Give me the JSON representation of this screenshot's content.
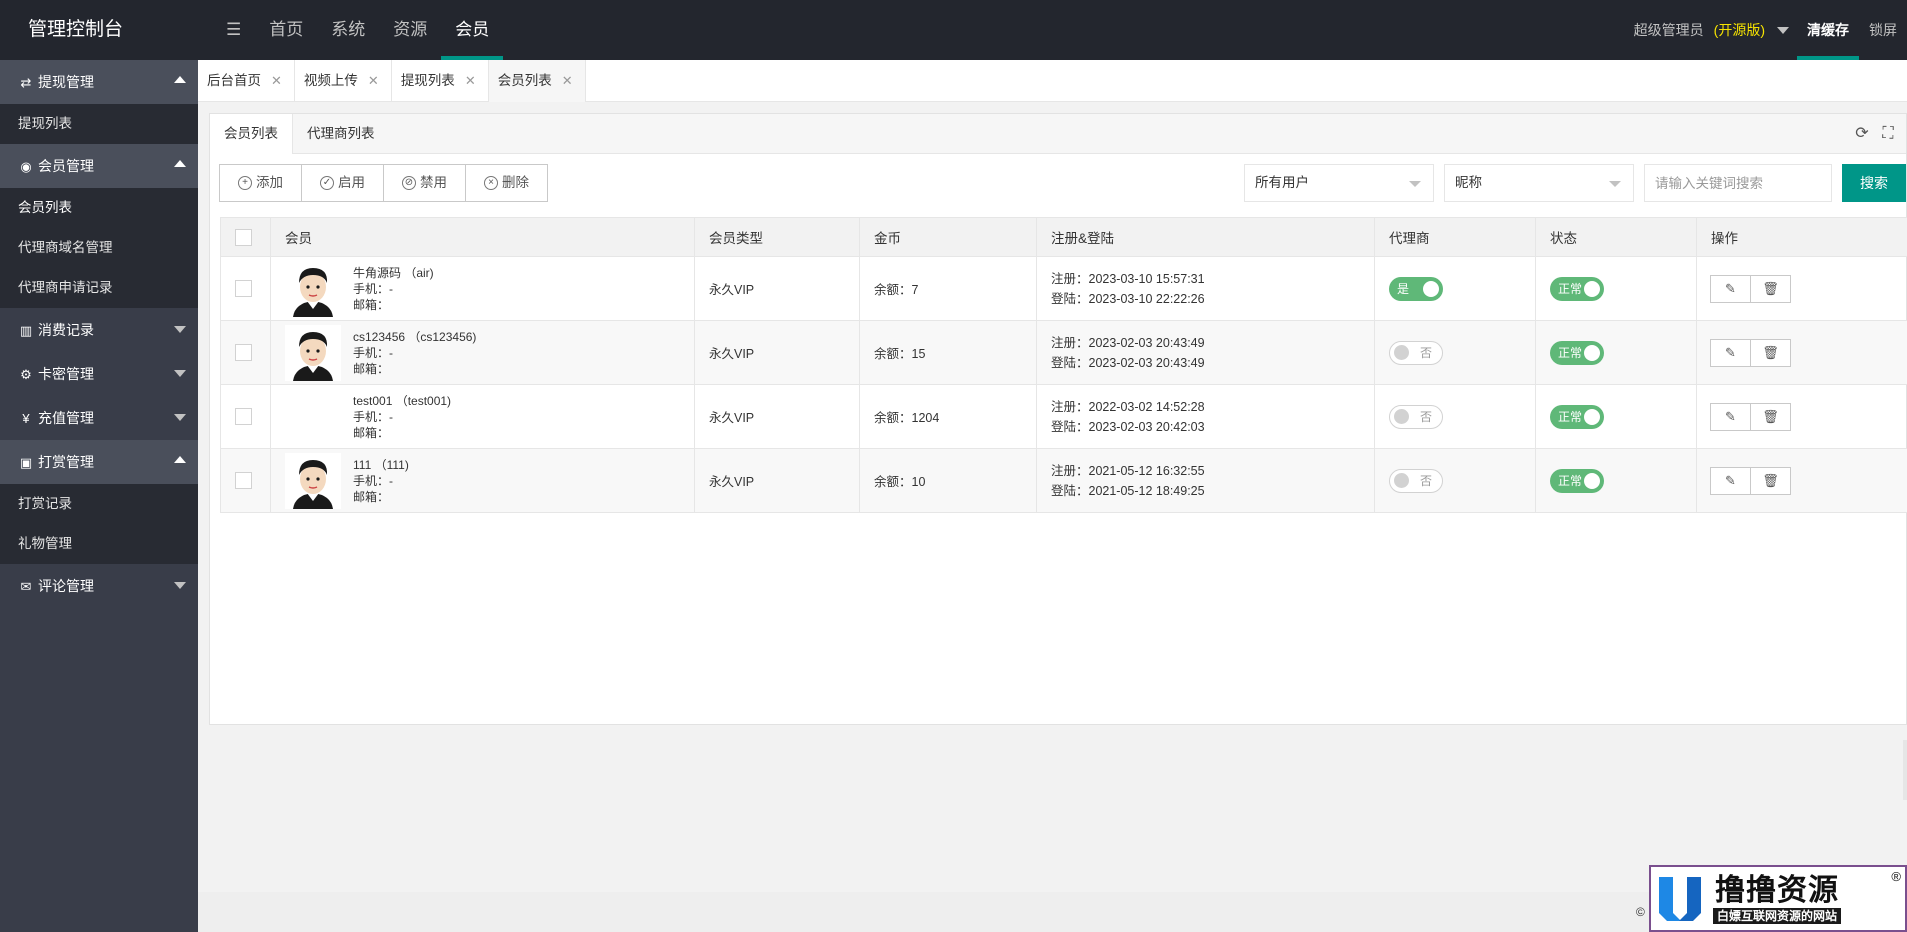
{
  "header": {
    "brand": "管理控制台",
    "menu_icon": "menu-icon",
    "nav": [
      "首页",
      "系统",
      "资源",
      "会员"
    ],
    "active_nav": "会员",
    "user": "超级管理员",
    "edition": "(开源版)",
    "clear_cache": "清缓存",
    "lock": "锁屏"
  },
  "sidebar": {
    "groups": [
      {
        "label": "提现管理",
        "icon": "exchange-icon",
        "open": true,
        "items": [
          "提现列表"
        ]
      },
      {
        "label": "会员管理",
        "icon": "user-circle-icon",
        "open": true,
        "items": [
          "会员列表",
          "代理商域名管理",
          "代理商申请记录"
        ]
      },
      {
        "label": "消费记录",
        "icon": "bar-chart-icon",
        "open": false,
        "items": []
      },
      {
        "label": "卡密管理",
        "icon": "gear-icon",
        "open": false,
        "items": []
      },
      {
        "label": "充值管理",
        "icon": "yen-icon",
        "open": false,
        "items": []
      },
      {
        "label": "打赏管理",
        "icon": "money-icon",
        "open": true,
        "items": [
          "打赏记录",
          "礼物管理"
        ]
      },
      {
        "label": "评论管理",
        "icon": "comment-icon",
        "open": false,
        "items": []
      }
    ]
  },
  "tabs": [
    {
      "label": "后台首页"
    },
    {
      "label": "视频上传"
    },
    {
      "label": "提现列表"
    },
    {
      "label": "会员列表",
      "active": true
    }
  ],
  "subtabs": [
    "会员列表",
    "代理商列表"
  ],
  "toolbar": {
    "add": "添加",
    "enable": "启用",
    "disable": "禁用",
    "delete": "删除"
  },
  "filters": {
    "user_type": "所有用户",
    "field": "昵称",
    "search_placeholder": "请输入关键词搜索",
    "search_button": "搜索"
  },
  "table": {
    "headers": [
      "会员",
      "会员类型",
      "金币",
      "注册&登陆",
      "代理商",
      "状态",
      "操作"
    ],
    "rows": [
      {
        "name": "牛角源码 （air)",
        "has_avatar": true,
        "phone": "手机：-",
        "email": "邮箱：",
        "type": "永久VIP",
        "balance": "余额：7",
        "register": "注册：2023-03-10 15:57:31",
        "login": "登陆：2023-03-10 22:22:26",
        "agent": "是",
        "agent_on": true,
        "status": "正常"
      },
      {
        "name": "cs123456 （cs123456)",
        "has_avatar": true,
        "phone": "手机：-",
        "email": "邮箱：",
        "type": "永久VIP",
        "balance": "余额：15",
        "register": "注册：2023-02-03 20:43:49",
        "login": "登陆：2023-02-03 20:43:49",
        "agent": "否",
        "agent_on": false,
        "status": "正常"
      },
      {
        "name": "test001 （test001)",
        "has_avatar": false,
        "phone": "手机：-",
        "email": "邮箱：",
        "type": "永久VIP",
        "balance": "余额：1204",
        "register": "注册：2022-03-02 14:52:28",
        "login": "登陆：2023-02-03 20:42:03",
        "agent": "否",
        "agent_on": false,
        "status": "正常"
      },
      {
        "name": "111 （111)",
        "has_avatar": true,
        "phone": "手机：-",
        "email": "邮箱：",
        "type": "永久VIP",
        "balance": "余额：10",
        "register": "注册：2021-05-12 16:32:55",
        "login": "登陆：2021-05-12 18:49:25",
        "agent": "否",
        "agent_on": false,
        "status": "正常"
      }
    ]
  },
  "footer": {
    "copyright": "©"
  },
  "watermark": {
    "title": "撸撸资源",
    "subtitle": "白嫖互联网资源的网站",
    "reg": "®"
  }
}
